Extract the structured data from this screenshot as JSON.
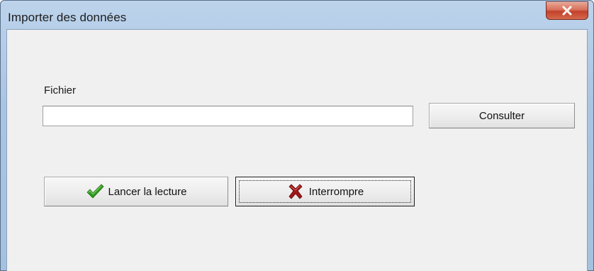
{
  "window": {
    "title": "Importer des données",
    "close_icon": "close-icon"
  },
  "form": {
    "file_label": "Fichier",
    "file_value": "",
    "browse_label": "Consulter"
  },
  "actions": {
    "start_label": "Lancer la lecture",
    "start_icon": "checkmark-icon",
    "start_icon_color": "#2e9a1f",
    "stop_label": "Interrompre",
    "stop_icon": "cross-icon",
    "stop_icon_color": "#a01818"
  }
}
